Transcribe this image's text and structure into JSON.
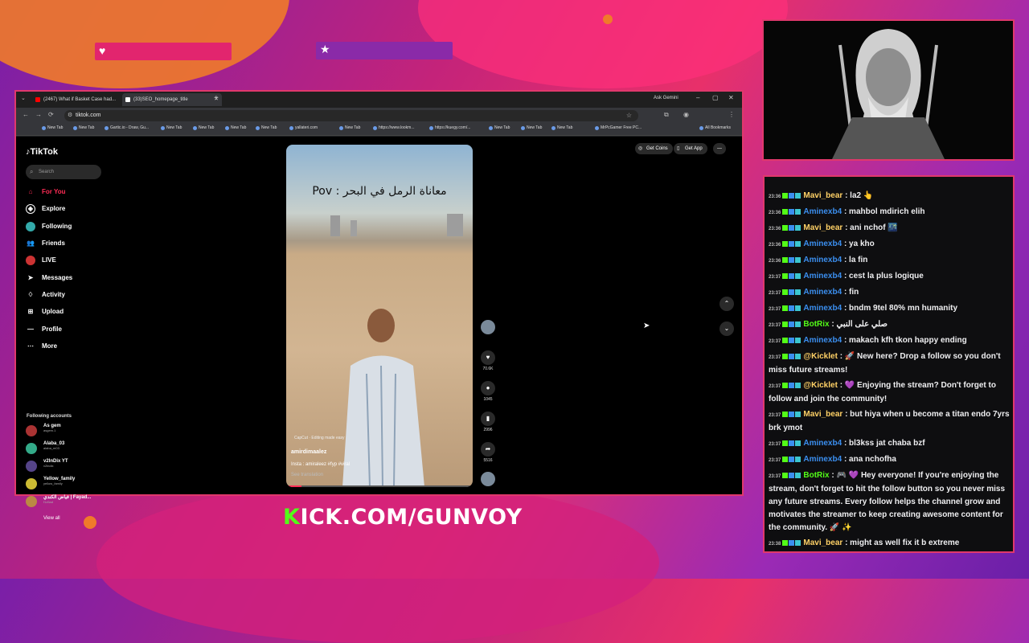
{
  "browser": {
    "tabs": [
      {
        "label": "(2467) What if Basket Case had...",
        "active": false,
        "color": "#ff0000"
      },
      {
        "label": "(33)SEO_homepage_title",
        "active": true,
        "color": "#ffffff"
      }
    ],
    "ask_gemini": "Ask Gemini",
    "url": "tiktok.com",
    "bookmarks": [
      "New Tab",
      "New Tab",
      "Gartic.io - Draw, Gu...",
      "New Tab",
      "New Tab",
      "New Tab",
      "New Tab",
      "yallateri.com",
      "New Tab",
      "https://www.lookm...",
      "https://kuegy.com/...",
      "New Tab",
      "New Tab",
      "New Tab",
      "MrPcGamer Free PC..."
    ],
    "all_bookmarks": "All Bookmarks"
  },
  "tiktok": {
    "logo": "TikTok",
    "search_placeholder": "Search",
    "nav": [
      {
        "label": "For You",
        "icon": "home-icon",
        "active": true
      },
      {
        "label": "Explore",
        "icon": "compass-icon"
      },
      {
        "label": "Following",
        "icon": "following-icon"
      },
      {
        "label": "Friends",
        "icon": "friends-icon"
      },
      {
        "label": "LIVE",
        "icon": "live-icon"
      },
      {
        "label": "Messages",
        "icon": "send-icon"
      },
      {
        "label": "Activity",
        "icon": "activity-icon"
      },
      {
        "label": "Upload",
        "icon": "upload-icon"
      },
      {
        "label": "Profile",
        "icon": "profile-icon"
      },
      {
        "label": "More",
        "icon": "more-icon"
      }
    ],
    "following_header": "Following accounts",
    "accounts": [
      {
        "name": "As gem",
        "handle": "asgem.1"
      },
      {
        "name": "Alaba_03",
        "handle": "alaba_m03"
      },
      {
        "name": "v2lnDix YT",
        "handle": "v2lndix"
      },
      {
        "name": "Yellow_family",
        "handle": "yellow_family"
      },
      {
        "name": "فياض الكندي | Fayad...",
        "handle": "f1z5ad"
      }
    ],
    "view_all": "View all",
    "get_coins": "Get Coins",
    "get_app": "Get App",
    "video": {
      "caption": "معاناة الرمل في البحر : Pov",
      "capcut": "CapCut · Editing made easy",
      "author": "amirdimaalez",
      "desc": "Insta : amiraleez #fyp #viral",
      "see_translation": "See translation"
    },
    "actions": [
      {
        "icon": "heart-icon",
        "count": "70.6K"
      },
      {
        "icon": "comment-icon",
        "count": "1045"
      },
      {
        "icon": "bookmark-icon",
        "count": "2996"
      },
      {
        "icon": "share-icon",
        "count": "5516"
      }
    ]
  },
  "overlay": {
    "kick_k": "K",
    "kick_rest": "ICK.COM/GUNVOY"
  },
  "chat": {
    "messages": [
      {
        "time": "23:36",
        "user": "Mavi_bear",
        "color": "#ffd166",
        "text": ": la2 👆"
      },
      {
        "time": "23:36",
        "user": "Aminexb4",
        "color": "#3b8ff0",
        "text": ": mahbol mdirich elih"
      },
      {
        "time": "23:36",
        "user": "Mavi_bear",
        "color": "#ffd166",
        "text": ": ani nchof 🌃"
      },
      {
        "time": "23:36",
        "user": "Aminexb4",
        "color": "#3b8ff0",
        "text": ": ya kho"
      },
      {
        "time": "23:36",
        "user": "Aminexb4",
        "color": "#3b8ff0",
        "text": ": la fin"
      },
      {
        "time": "23:37",
        "user": "Aminexb4",
        "color": "#3b8ff0",
        "text": ": cest la plus logique"
      },
      {
        "time": "23:37",
        "user": "Aminexb4",
        "color": "#3b8ff0",
        "text": ": fin"
      },
      {
        "time": "23:37",
        "user": "Aminexb4",
        "color": "#3b8ff0",
        "text": ": bndm 9tel 80% mn humanity"
      },
      {
        "time": "23:37",
        "user": "BotRix",
        "color": "#53fc18",
        "text": ": صلي على النبي"
      },
      {
        "time": "23:37",
        "user": "Aminexb4",
        "color": "#3b8ff0",
        "text": ": makach kfh tkon happy ending"
      },
      {
        "time": "23:37",
        "user": "@Kicklet",
        "color": "#ffd166",
        "text": ": 🚀 New here? Drop a follow so you don't miss future streams!"
      },
      {
        "time": "23:37",
        "user": "@Kicklet",
        "color": "#ffd166",
        "text": ": 💜 Enjoying the stream? Don't forget to follow and join the community!"
      },
      {
        "time": "23:37",
        "user": "Mavi_bear",
        "color": "#ffd166",
        "text": ": but hiya when u become a titan endo 7yrs brk ymot"
      },
      {
        "time": "23:37",
        "user": "Aminexb4",
        "color": "#3b8ff0",
        "text": ": bl3kss jat chaba bzf"
      },
      {
        "time": "23:37",
        "user": "Aminexb4",
        "color": "#3b8ff0",
        "text": ": ana nchofha"
      },
      {
        "time": "23:37",
        "user": "BotRix",
        "color": "#53fc18",
        "text": ": 🎮 💜 Hey everyone! If you're enjoying the stream, don't forget to hit the follow button so you never miss any future streams. Every follow helps the channel grow and motivates the streamer to keep creating awesome content for the community. 🚀 ✨"
      },
      {
        "time": "23:38",
        "user": "Mavi_bear",
        "color": "#ffd166",
        "text": ": might as well fix it b extreme"
      }
    ]
  }
}
